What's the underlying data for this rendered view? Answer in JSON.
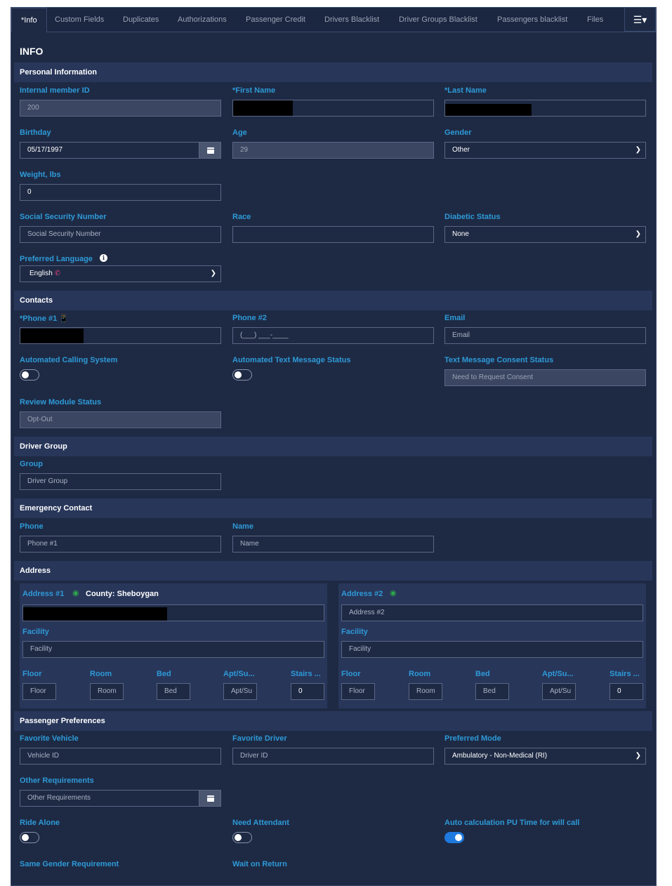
{
  "tabs": [
    "*Info",
    "Custom Fields",
    "Duplicates",
    "Authorizations",
    "Passenger Credit",
    "Drivers Blacklist",
    "Driver Groups Blacklist",
    "Passengers blacklist",
    "Files"
  ],
  "menu_icon": "hamburger-icon",
  "page_title": "INFO",
  "personal": {
    "title": "Personal Information",
    "member_id_label": "Internal member ID",
    "member_id_value": "200",
    "first_name_label": "*First Name",
    "last_name_label": "*Last Name",
    "birthday_label": "Birthday",
    "birthday_value": "05/17/1997",
    "age_label": "Age",
    "age_value": "29",
    "gender_label": "Gender",
    "gender_value": "Other",
    "weight_label": "Weight, lbs",
    "weight_value": "0",
    "ssn_label": "Social Security Number",
    "ssn_placeholder": "Social Security Number",
    "race_label": "Race",
    "diabetic_label": "Diabetic Status",
    "diabetic_value": "None",
    "language_label": "Preferred Language",
    "language_value": "English",
    "info_glyph": "i"
  },
  "contacts": {
    "title": "Contacts",
    "phone1_label": "*Phone #1",
    "phone2_label": "Phone #2",
    "phone2_placeholder": "(___) ___-____",
    "email_label": "Email",
    "email_placeholder": "Email",
    "auto_call_label": "Automated Calling System",
    "auto_call_on": false,
    "auto_text_label": "Automated Text Message Status",
    "auto_text_on": false,
    "text_consent_label": "Text Message Consent Status",
    "text_consent_value": "Need to Request Consent",
    "review_label": "Review Module Status",
    "review_value": "Opt-Out"
  },
  "driver_group": {
    "title": "Driver Group",
    "group_label": "Group",
    "group_placeholder": "Driver Group"
  },
  "emergency": {
    "title": "Emergency Contact",
    "phone_label": "Phone",
    "phone_placeholder": "Phone #1",
    "name_label": "Name",
    "name_placeholder": "Name"
  },
  "address": {
    "title": "Address",
    "addr1_label": "Address #1",
    "county_text": "County: Sheboygan",
    "addr2_label": "Address #2",
    "addr2_placeholder": "Address #2",
    "facility_label": "Facility",
    "facility_placeholder": "Facility",
    "floor_label": "Floor",
    "floor_placeholder": "Floor",
    "room_label": "Room",
    "room_placeholder": "Room",
    "bed_label": "Bed",
    "bed_placeholder": "Bed",
    "apt_label": "Apt/Su...",
    "apt_placeholder": "Apt/Su",
    "stairs_label": "Stairs ...",
    "stairs_value": "0"
  },
  "preferences": {
    "title": "Passenger Preferences",
    "vehicle_label": "Favorite Vehicle",
    "vehicle_placeholder": "Vehicle ID",
    "driver_label": "Favorite Driver",
    "driver_placeholder": "Driver ID",
    "mode_label": "Preferred Mode",
    "mode_value": "Ambulatory - Non-Medical (RI)",
    "other_label": "Other Requirements",
    "other_placeholder": "Other Requirements",
    "ride_alone_label": "Ride Alone",
    "ride_alone_on": false,
    "attendant_label": "Need Attendant",
    "attendant_on": false,
    "auto_pu_label": "Auto calculation PU Time for will call",
    "auto_pu_on": true,
    "same_gender_label": "Same Gender Requirement",
    "wait_label": "Wait on Return"
  },
  "colors": {
    "background": "#1e2a44",
    "section_bar": "#28365a",
    "label": "#2e9ad8",
    "toggle_on": "#1f7ae0",
    "pin_icon": "#2ea84a",
    "phone_icon": "#e0a020"
  }
}
